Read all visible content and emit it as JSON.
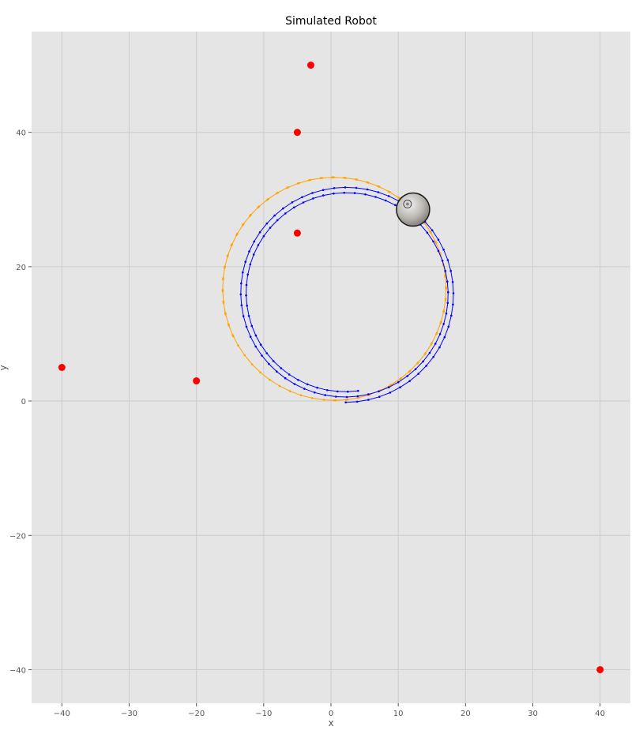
{
  "chart_data": {
    "type": "scatter",
    "title": "Simulated Robot",
    "xlabel": "x",
    "ylabel": "y",
    "xlim": [
      -44.5,
      44.5
    ],
    "ylim": [
      -45,
      55
    ],
    "x_ticks": [
      -40,
      -30,
      -20,
      -10,
      0,
      10,
      20,
      30,
      40
    ],
    "y_ticks": [
      -40,
      -20,
      0,
      20,
      40
    ],
    "x_tick_labels": [
      "−40",
      "−30",
      "−20",
      "−10",
      "0",
      "10",
      "20",
      "30",
      "40"
    ],
    "y_tick_labels": [
      "−40",
      "−20",
      "0",
      "20",
      "40"
    ],
    "grid": true,
    "colors": {
      "background": "#e5e5e5",
      "grid": "#cccccc",
      "landmark": "#ff0000",
      "true_path": "#ffa500",
      "estimated_path": "#0000ff"
    },
    "landmarks": [
      {
        "x": -3,
        "y": 50
      },
      {
        "x": -5,
        "y": 40
      },
      {
        "x": -5,
        "y": 25
      },
      {
        "x": -40,
        "y": 5
      },
      {
        "x": -20,
        "y": 3
      },
      {
        "x": 40,
        "y": -40
      }
    ],
    "series": [
      {
        "kind": "true_path",
        "style": "orange dotted line",
        "center": [
          0.5,
          16.7
        ],
        "radius": 16.6,
        "turns": 1.82
      },
      {
        "kind": "estimated_path",
        "style": "blue dotted line",
        "center": [
          2.2,
          16.0
        ],
        "radius_start": 16.2,
        "radius_end": 14.6,
        "turns": 2.02
      }
    ],
    "robot": {
      "x": 12.2,
      "y": 28.5,
      "icon": "robot-disc-icon"
    }
  }
}
